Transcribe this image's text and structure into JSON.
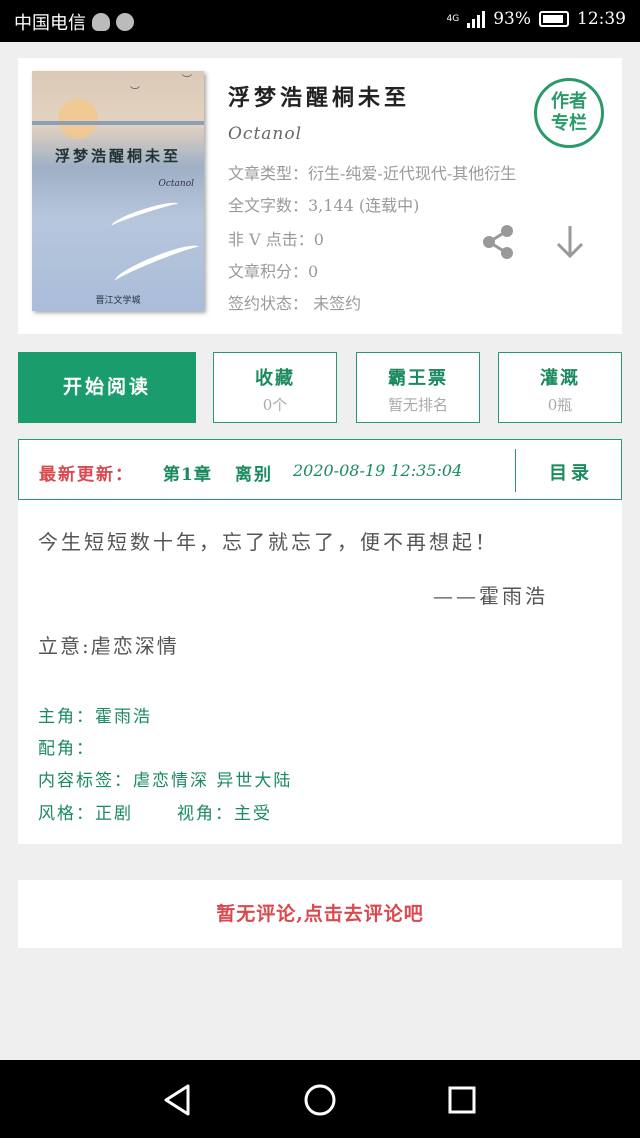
{
  "status_bar": {
    "carrier": "中国电信",
    "network": "4G",
    "battery": "93%",
    "time": "12:39"
  },
  "book": {
    "title": "浮梦浩醒桐未至",
    "author": "Octanol",
    "cover_title": "浮梦浩醒桐未至",
    "cover_author": "Octanol",
    "cover_publisher": "晋江文学城",
    "meta": [
      "文章类型：衍生-纯爱-近代现代-其他衍生",
      "全文字数：3,144 (连载中)",
      "非 V 点击：0",
      "文章积分：0",
      "签约状态： 未签约"
    ],
    "author_badge": [
      "作者",
      "专栏"
    ]
  },
  "actions": {
    "start_reading": "开始阅读",
    "favorite": {
      "label": "收藏",
      "value": "0个"
    },
    "bawang": {
      "label": "霸王票",
      "value": "暂无排名"
    },
    "nutrient": {
      "label": "灌溉",
      "value": "0瓶"
    }
  },
  "update": {
    "label": "最新更新：",
    "chapter": "第1章",
    "chapter_title": "离别",
    "time": "2020-08-19 12:35:04",
    "toc": "目录"
  },
  "summary": {
    "quote": "今生短短数十年，忘了就忘了，便不再想起！",
    "quote_author": "——霍雨浩",
    "theme": "立意:虐恋深情",
    "protagonist": "主角：霍雨浩",
    "supporting": "配角：",
    "tags": "内容标签：虐恋情深 异世大陆",
    "style": "风格：正剧",
    "perspective": "视角：主受"
  },
  "comment": "暂无评论,点击去评论吧",
  "colors": {
    "accent": "#1b9c6c",
    "alert": "#d9494e",
    "background": "#efefef"
  },
  "icons": [
    "qq-icon",
    "notification-icon",
    "signal-icon",
    "battery-icon",
    "share-icon",
    "download-icon",
    "back-icon",
    "home-icon",
    "recent-apps-icon"
  ]
}
